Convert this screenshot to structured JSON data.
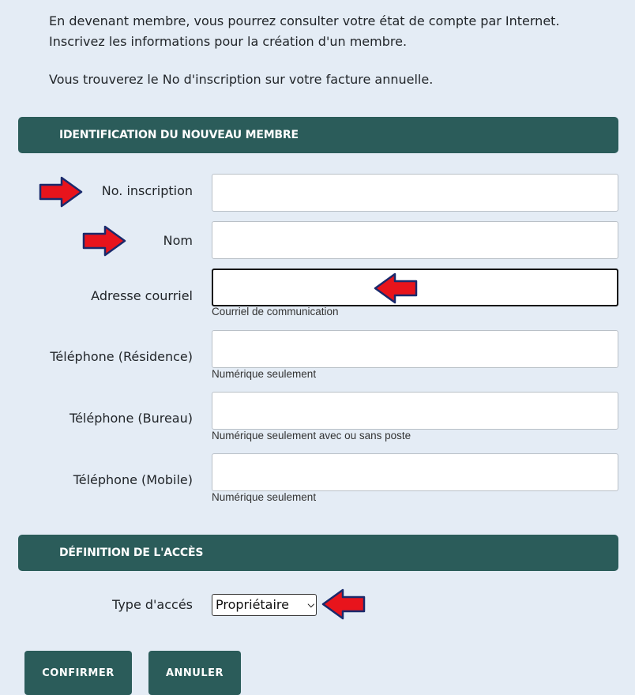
{
  "intro": {
    "line1": "En devenant membre, vous pourrez consulter votre état de compte par Internet.",
    "line2": "Inscrivez les informations pour la création d'un membre.",
    "line3": "Vous trouverez le No d'inscription sur votre facture annuelle."
  },
  "section_identification": {
    "title": "IDENTIFICATION DU NOUVEAU MEMBRE",
    "fields": [
      {
        "label": "No. inscription",
        "value": "",
        "hint": ""
      },
      {
        "label": "Nom",
        "value": "",
        "hint": ""
      },
      {
        "label": "Adresse courriel",
        "value": "",
        "hint": "Courriel de communication"
      },
      {
        "label": "Téléphone (Résidence)",
        "value": "",
        "hint": "Numérique seulement"
      },
      {
        "label": "Téléphone (Bureau)",
        "value": "",
        "hint": "Numérique seulement avec ou sans poste"
      },
      {
        "label": "Téléphone (Mobile)",
        "value": "",
        "hint": "Numérique seulement"
      }
    ]
  },
  "section_access": {
    "title": "DÉFINITION DE L'ACCÈS",
    "type_label": "Type d'accés",
    "type_selected": "Propriétaire"
  },
  "buttons": {
    "confirm": "CONFIRMER",
    "cancel": "ANNULER"
  },
  "colors": {
    "header_bg": "#2b5c5a",
    "page_bg": "#e4ecf5",
    "arrow_fill": "#e8141c",
    "arrow_stroke": "#1a2a6c"
  }
}
